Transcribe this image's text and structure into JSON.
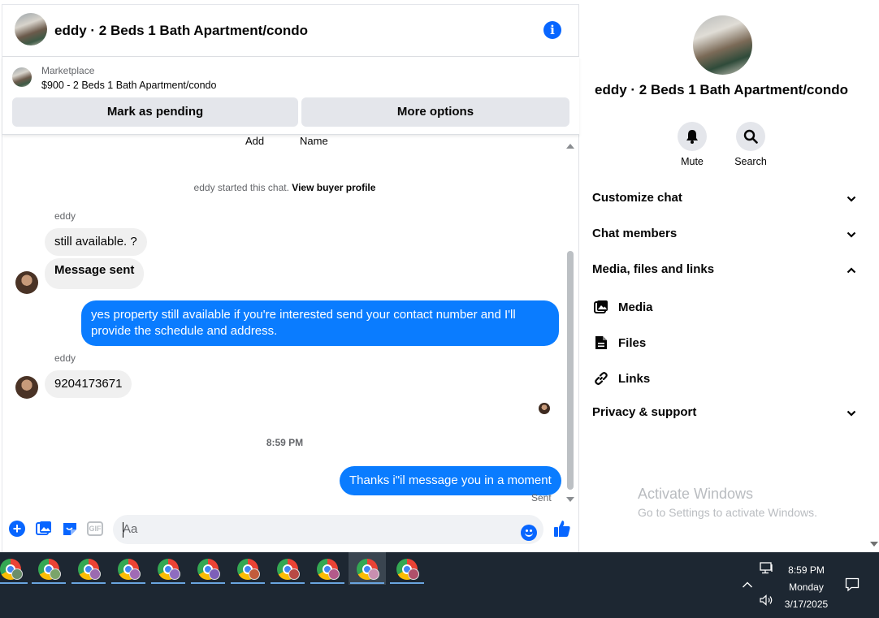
{
  "header": {
    "title": "eddy · 2 Beds 1 Bath Apartment/condo"
  },
  "marketplace": {
    "label": "Marketplace",
    "listing": "$900 - 2 Beds 1 Bath Apartment/condo",
    "mark_pending": "Mark as pending",
    "more_options": "More options"
  },
  "messages": {
    "cut_labels": [
      "Add",
      "Name"
    ],
    "started_text": "eddy started this chat.",
    "view_profile": "View buyer profile",
    "sender_name": "eddy",
    "in_1": "still available.  ?",
    "in_2": "Message sent",
    "out_1": "yes property still available if you're interested send your contact number and I'll provide the schedule and address.",
    "in_3": "9204173671",
    "time": "8:59 PM",
    "out_2": "Thanks i\"il message you in a moment",
    "status": "Sent"
  },
  "composer": {
    "placeholder": "Aa",
    "gif": "GIF"
  },
  "panel": {
    "title": "eddy · 2 Beds 1 Bath Apartment/condo",
    "mute": "Mute",
    "search": "Search",
    "rows": [
      "Customize chat",
      "Chat members",
      "Media, files and links"
    ],
    "subrows": [
      "Media",
      "Files",
      "Links"
    ],
    "privacy": "Privacy & support"
  },
  "watermark": {
    "line1": "Activate Windows",
    "line2": "Go to Settings to activate Windows."
  },
  "taskbar": {
    "time": "8:59 PM",
    "day": "Monday",
    "date": "3/17/2025",
    "app_count": 11,
    "active_index": 9
  },
  "colors": {
    "accent": "#0866ff",
    "bubble_out": "#0a7cff",
    "bubble_in": "#f0f0f0",
    "taskbar": "#1d2732"
  }
}
